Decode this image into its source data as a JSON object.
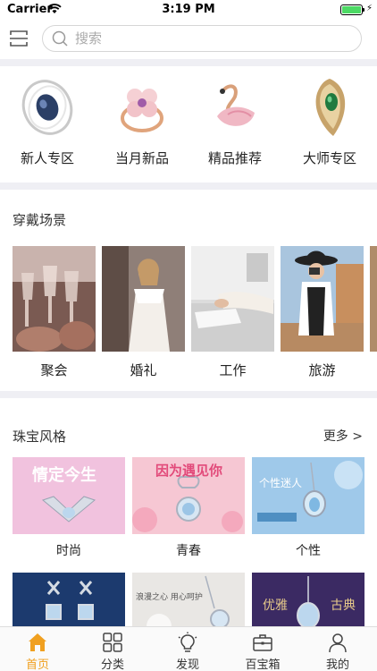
{
  "status_bar": {
    "carrier": "Carrier",
    "time": "3:19 PM",
    "battery_level": 1.0
  },
  "search": {
    "placeholder": "搜索"
  },
  "zones": [
    {
      "label": "新人专区",
      "icon": "sapphire-brooch-icon"
    },
    {
      "label": "当月新品",
      "icon": "flower-ring-icon"
    },
    {
      "label": "精品推荐",
      "icon": "swan-brooch-icon"
    },
    {
      "label": "大师专区",
      "icon": "emerald-brooch-icon"
    }
  ],
  "wear_scenes": {
    "title": "穿戴场景",
    "items": [
      {
        "label": "聚会"
      },
      {
        "label": "婚礼"
      },
      {
        "label": "工作"
      },
      {
        "label": "旅游"
      }
    ]
  },
  "jewelry_styles": {
    "title": "珠宝风格",
    "more": "更多 >",
    "items": [
      {
        "label": "时尚",
        "banner_text": "情定今生"
      },
      {
        "label": "青春",
        "banner_text": "因为遇见你"
      },
      {
        "label": "个性",
        "banner_text": "个性迷人"
      }
    ],
    "second_row": [
      {
        "banner_text": ""
      },
      {
        "banner_text": "浪漫之心 用心呵护"
      },
      {
        "banner_text_left": "优雅",
        "banner_text_right": "古典"
      }
    ]
  },
  "tabs": [
    {
      "label": "首页",
      "icon": "home-icon",
      "active": true
    },
    {
      "label": "分类",
      "icon": "grid-icon",
      "active": false
    },
    {
      "label": "发现",
      "icon": "lightbulb-icon",
      "active": false
    },
    {
      "label": "百宝箱",
      "icon": "toolbox-icon",
      "active": false
    },
    {
      "label": "我的",
      "icon": "user-icon",
      "active": false
    }
  ],
  "colors": {
    "accent": "#f0a020",
    "divider": "#efeff4"
  }
}
